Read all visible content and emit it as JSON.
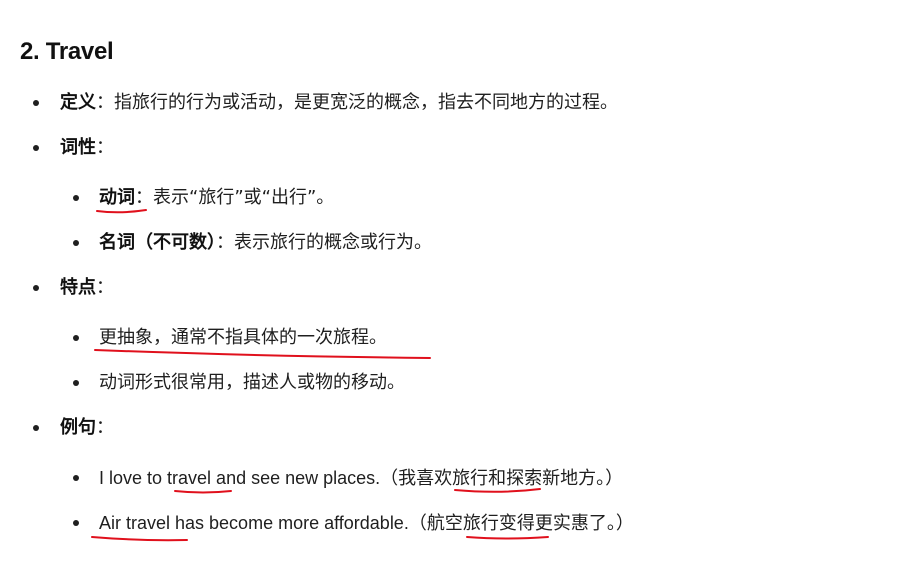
{
  "heading": "2. Travel",
  "items": [
    {
      "label": "定义",
      "sep": "：",
      "text": "指旅行的行为或活动，是更宽泛的概念，指去不同地方的过程。"
    },
    {
      "label": "词性",
      "sep": "："
    },
    {
      "label": "动词",
      "sep": "：",
      "text": "表示“旅行”或“出行”。"
    },
    {
      "label": "名词（不可数）",
      "sep": "：",
      "text": "表示旅行的概念或行为。"
    },
    {
      "label": "特点",
      "sep": "："
    },
    {
      "text": "更抽象，通常不指具体的一次旅程。"
    },
    {
      "text": "动词形式很常用，描述人或物的移动。"
    },
    {
      "label": "例句",
      "sep": "："
    },
    {
      "en": "I love to travel and see new places.",
      "zh": "（我喜欢旅行和探索新地方。）"
    },
    {
      "en": "Air travel has become more affordable.",
      "zh": "（航空旅行变得更实惠了。）"
    }
  ],
  "colors": {
    "annotation": "#e0101c"
  }
}
